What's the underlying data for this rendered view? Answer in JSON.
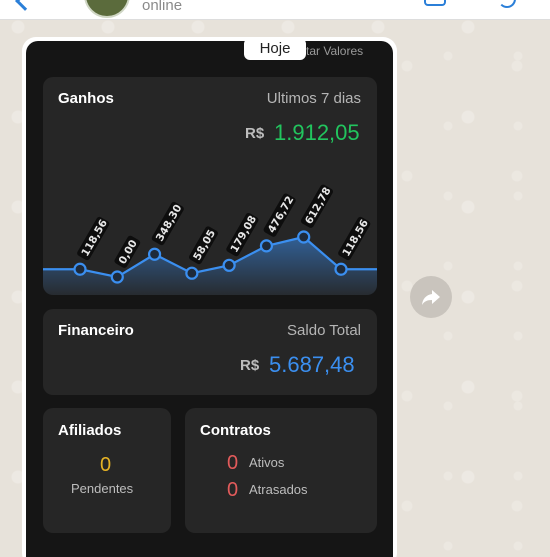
{
  "header": {
    "status": "online"
  },
  "message": {
    "date_pill": "Hoje",
    "hint": "tar Valores"
  },
  "ganhos": {
    "title": "Ganhos",
    "period": "Ultimos 7 dias",
    "currency": "R$",
    "total": "1.912,05",
    "colors": {
      "value": "#22c55e",
      "line": "#3b8ff0"
    }
  },
  "chart_data": {
    "type": "area",
    "x": [
      1,
      2,
      3,
      4,
      5,
      6,
      7,
      8
    ],
    "values": [
      118.56,
      0.0,
      348.3,
      58.05,
      179.08,
      476.72,
      612.78,
      118.56
    ],
    "labels": [
      "118,56",
      "0,00",
      "348,30",
      "58,05",
      "179,08",
      "476,72",
      "612,78",
      "118,56"
    ],
    "title": "",
    "xlabel": "",
    "ylabel": "",
    "grid": false
  },
  "financeiro": {
    "title": "Financeiro",
    "subtitle": "Saldo Total",
    "currency": "R$",
    "total": "5.687,48"
  },
  "afiliados": {
    "title": "Afiliados",
    "count": "0",
    "label": "Pendentes",
    "color": "#e6b325"
  },
  "contratos": {
    "title": "Contratos",
    "ativos_count": "0",
    "ativos_label": "Ativos",
    "atrasados_count": "0",
    "atrasados_label": "Atrasados",
    "color": "#e25b5b"
  },
  "icons": {
    "forward": "forward-arrow-icon"
  }
}
